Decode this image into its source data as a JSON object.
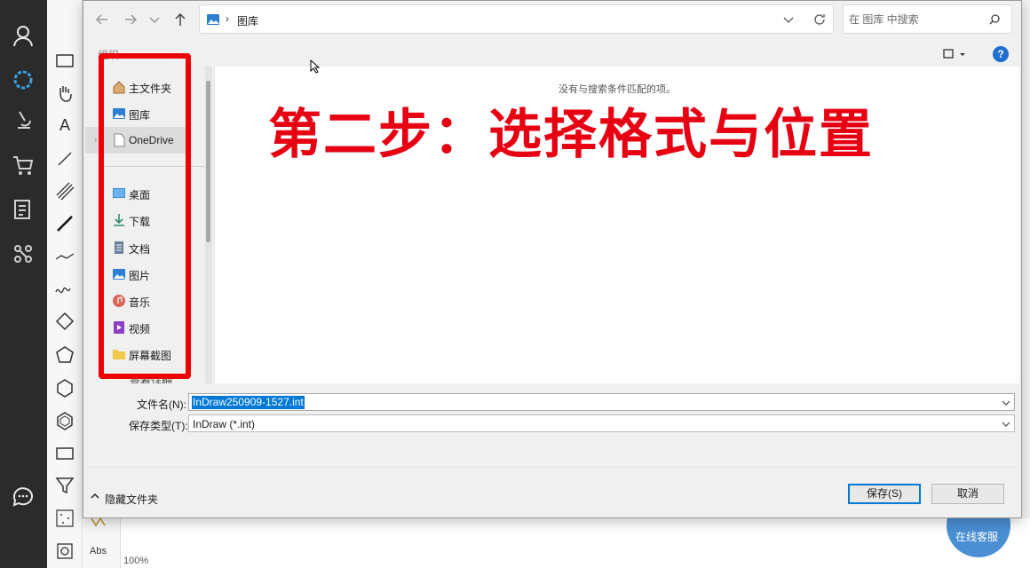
{
  "dialog": {
    "address": {
      "path_label": "图库",
      "separator": "›"
    },
    "search": {
      "placeholder": "在 图库 中搜索"
    },
    "organize_label": "组织",
    "help_label": "?",
    "nav": {
      "items": [
        {
          "label": "主文件夹",
          "icon": "home-icon"
        },
        {
          "label": "图库",
          "icon": "gallery-icon"
        },
        {
          "label": "OneDrive",
          "icon": "onedrive-icon"
        },
        {
          "label": "桌面",
          "icon": "desktop-icon"
        },
        {
          "label": "下载",
          "icon": "download-icon"
        },
        {
          "label": "文档",
          "icon": "documents-icon"
        },
        {
          "label": "图片",
          "icon": "pictures-icon"
        },
        {
          "label": "音乐",
          "icon": "music-icon"
        },
        {
          "label": "视频",
          "icon": "videos-icon"
        },
        {
          "label": "屏幕截图",
          "icon": "folder-icon"
        }
      ],
      "partial_item": "查看详细"
    },
    "file_area": {
      "empty_message": "没有与搜索条件匹配的项。"
    },
    "overlay_title": "第二步：选择格式与位置",
    "filename": {
      "label": "文件名(N):",
      "value": "InDraw250909-1527.int"
    },
    "filetype": {
      "label": "保存类型(T):",
      "value": "InDraw (*.int)"
    },
    "hide_folders_label": "隐藏文件夹",
    "save_label": "保存(S)",
    "cancel_label": "取消",
    "colors": {
      "highlight": "#ee0000",
      "overlay_text": "#e60012",
      "accent": "#0078d7"
    }
  },
  "app": {
    "abs_label": "Abs",
    "zoom_label": "100%",
    "service_label": "在线客服"
  }
}
